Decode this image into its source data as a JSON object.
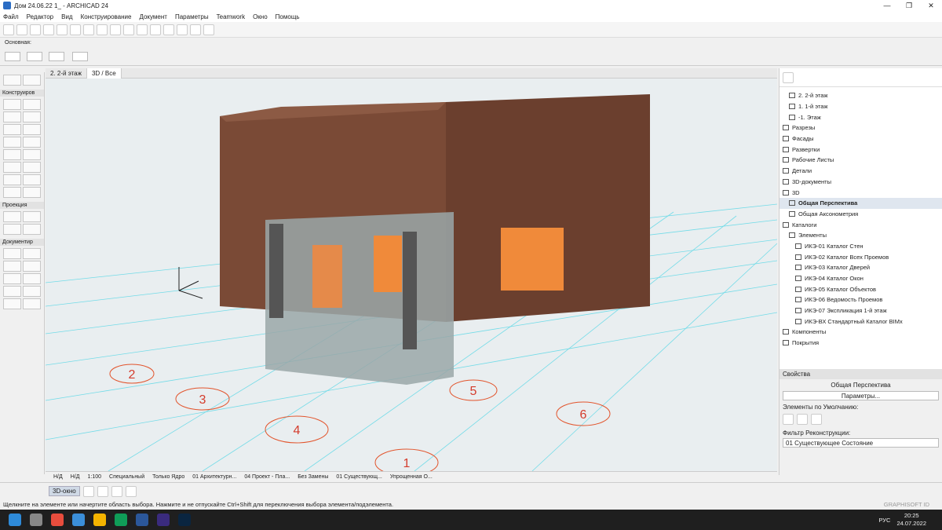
{
  "window": {
    "title": "Дом 24.06.22 1_ - ARCHICAD 24",
    "controls": [
      "—",
      "❐",
      "✕"
    ]
  },
  "menu": [
    "Файл",
    "Редактор",
    "Вид",
    "Конструирование",
    "Документ",
    "Параметры",
    "Teamwork",
    "Окно",
    "Помощь"
  ],
  "infobox": {
    "label": "Основная:"
  },
  "toolbox": {
    "sections": [
      "Конструиров",
      "Проекция",
      "Документир"
    ]
  },
  "tabs": [
    {
      "label": "2. 2-й этаж"
    },
    {
      "label": "3D / Все"
    }
  ],
  "viewport": {
    "grid_labels": [
      "2",
      "3",
      "4",
      "5",
      "6",
      "1",
      "2"
    ]
  },
  "navigator": {
    "items": [
      {
        "label": "2. 2-й этаж",
        "selected": false
      },
      {
        "label": "1. 1-й этаж",
        "selected": false
      },
      {
        "label": "-1. Этаж",
        "selected": false
      },
      {
        "label": "Разрезы",
        "selected": false
      },
      {
        "label": "Фасады",
        "selected": false
      },
      {
        "label": "Развертки",
        "selected": false
      },
      {
        "label": "Рабочие Листы",
        "selected": false
      },
      {
        "label": "Детали",
        "selected": false
      },
      {
        "label": "3D-документы",
        "selected": false
      },
      {
        "label": "3D",
        "selected": false
      },
      {
        "label": "Общая Перспектива",
        "selected": true
      },
      {
        "label": "Общая Аксонометрия",
        "selected": false
      },
      {
        "label": "Каталоги",
        "selected": false
      },
      {
        "label": "Элементы",
        "selected": false
      },
      {
        "label": "ИКЭ-01 Каталог Стен",
        "selected": false
      },
      {
        "label": "ИКЭ-02 Каталог Всех Проемов",
        "selected": false
      },
      {
        "label": "ИКЭ-03 Каталог Дверей",
        "selected": false
      },
      {
        "label": "ИКЭ-04 Каталог Окон",
        "selected": false
      },
      {
        "label": "ИКЭ-05 Каталог Объектов",
        "selected": false
      },
      {
        "label": "ИКЭ-06 Ведомость Проемов",
        "selected": false
      },
      {
        "label": "ИКЭ-07 Экспликация 1-й этаж",
        "selected": false
      },
      {
        "label": "ИКЭ-ВХ Стандартный Каталог BIMx",
        "selected": false
      },
      {
        "label": "Компоненты",
        "selected": false
      },
      {
        "label": "Покрытия",
        "selected": false
      }
    ]
  },
  "properties": {
    "header": "Свойства",
    "name": "Общая Перспектива",
    "params_button": "Параметры...",
    "defaults_label": "Элементы по Умолчанию:",
    "filter_label": "Фильтр Реконструкции:",
    "filter_value": "01 Существующее Состояние"
  },
  "bottombar": [
    "Н/Д",
    "Н/Д",
    "1:100",
    "Специальный",
    "Только Ядро",
    "01 Архитектурн...",
    "04 Проект - Пла...",
    "Без Замены",
    "01 Существующ...",
    "Упрощенная О..."
  ],
  "bottombar2": {
    "view3d": "3D-окно"
  },
  "status": {
    "text": "Щелкните на элементе или начертите область выбора. Нажмите и не отпускайте Ctrl+Shift для переключения выбора элемента/подэлемента.",
    "brand": "GRAPHISOFT ID"
  },
  "taskbar": {
    "lang": "РУС",
    "time": "20:25",
    "date": "24.07.2022"
  }
}
